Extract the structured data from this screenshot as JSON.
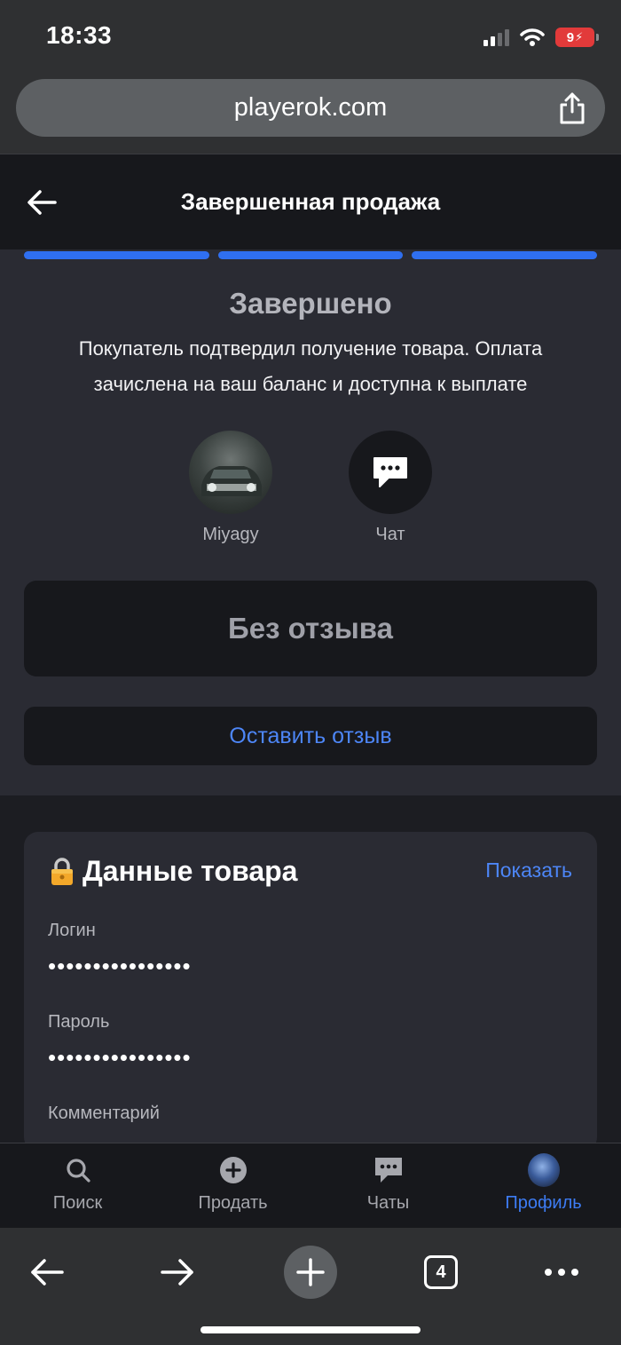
{
  "status_bar": {
    "time": "18:33",
    "battery_level": "9"
  },
  "browser": {
    "url": "playerok.com",
    "tabs_count": "4"
  },
  "header": {
    "title": "Завершенная продажа"
  },
  "deal": {
    "status_title": "Завершено",
    "status_description": "Покупатель подтвердил получение товара. Оплата зачислена на ваш баланс и доступна к выплате",
    "buyer_name": "Miyagy",
    "chat_label": "Чат",
    "review_status": "Без отзыва",
    "leave_review_label": "Оставить отзыв"
  },
  "product_data": {
    "title": "Данные товара",
    "show_label": "Показать",
    "login_label": "Логин",
    "login_value": "••••••••••••••••",
    "password_label": "Пароль",
    "password_value": "••••••••••••••••",
    "comment_label": "Комментарий"
  },
  "tab_bar": {
    "items": [
      {
        "label": "Поиск",
        "icon": "search-icon"
      },
      {
        "label": "Продать",
        "icon": "plus-circle-icon"
      },
      {
        "label": "Чаты",
        "icon": "chat-icon"
      },
      {
        "label": "Профиль",
        "icon": "avatar"
      }
    ],
    "active_index": 3
  },
  "colors": {
    "accent": "#3d7cf4",
    "progress": "#2f6ff0",
    "battery_low": "#e23a3a"
  }
}
